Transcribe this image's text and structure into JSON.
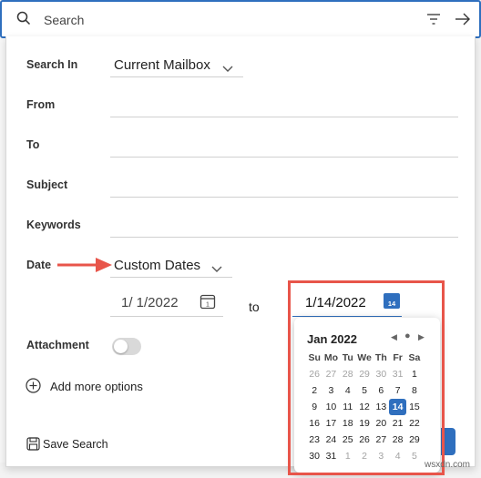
{
  "search": {
    "placeholder": "Search"
  },
  "form": {
    "search_in_label": "Search In",
    "search_in_value": "Current Mailbox",
    "from_label": "From",
    "to_label": "To",
    "subject_label": "Subject",
    "keywords_label": "Keywords",
    "date_label": "Date",
    "date_value": "Custom Dates",
    "start_date": "1/ 1/2022",
    "to_word": "to",
    "end_date": "1/14/2022",
    "end_calendar_icon_day": "14",
    "attachment_label": "Attachment",
    "add_more": "Add more options",
    "save_search": "Save Search"
  },
  "calendar": {
    "month": "Jan 2022",
    "weekdays": [
      "Su",
      "Mo",
      "Tu",
      "We",
      "Th",
      "Fr",
      "Sa"
    ],
    "weeks": [
      [
        "26",
        "27",
        "28",
        "29",
        "30",
        "31",
        "1"
      ],
      [
        "2",
        "3",
        "4",
        "5",
        "6",
        "7",
        "8"
      ],
      [
        "9",
        "10",
        "11",
        "12",
        "13",
        "14",
        "15"
      ],
      [
        "16",
        "17",
        "18",
        "19",
        "20",
        "21",
        "22"
      ],
      [
        "23",
        "24",
        "25",
        "26",
        "27",
        "28",
        "29"
      ],
      [
        "30",
        "31",
        "1",
        "2",
        "3",
        "4",
        "5"
      ]
    ],
    "selected_day": "14"
  },
  "colors": {
    "accent": "#2f6fbe",
    "annotation": "#e8554a"
  },
  "watermark": "wsxdn.com"
}
